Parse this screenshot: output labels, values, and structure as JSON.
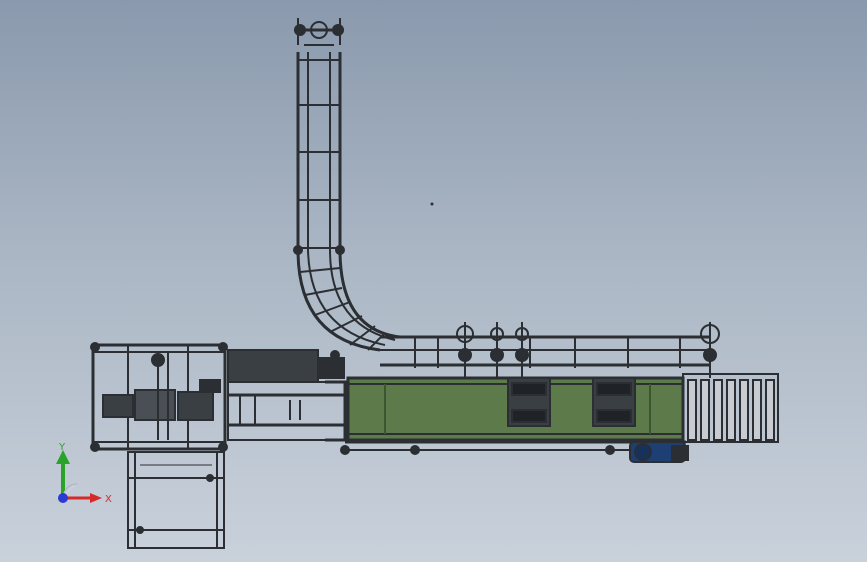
{
  "viewport": {
    "background_top": "#8a99ad",
    "background_bottom": "#c9d1db"
  },
  "model": {
    "frame_color": "#2b2f33",
    "belt_color": "#5c7a4a",
    "roller_color": "#c8ccd2",
    "motor_color": "#1d3f73"
  },
  "triad": {
    "x_label": "X",
    "y_label": "Y",
    "x_color": "#d42a2a",
    "y_color": "#2aa32a",
    "z_color": "#2a3bd4",
    "icon": "coordinate-triad-icon"
  }
}
